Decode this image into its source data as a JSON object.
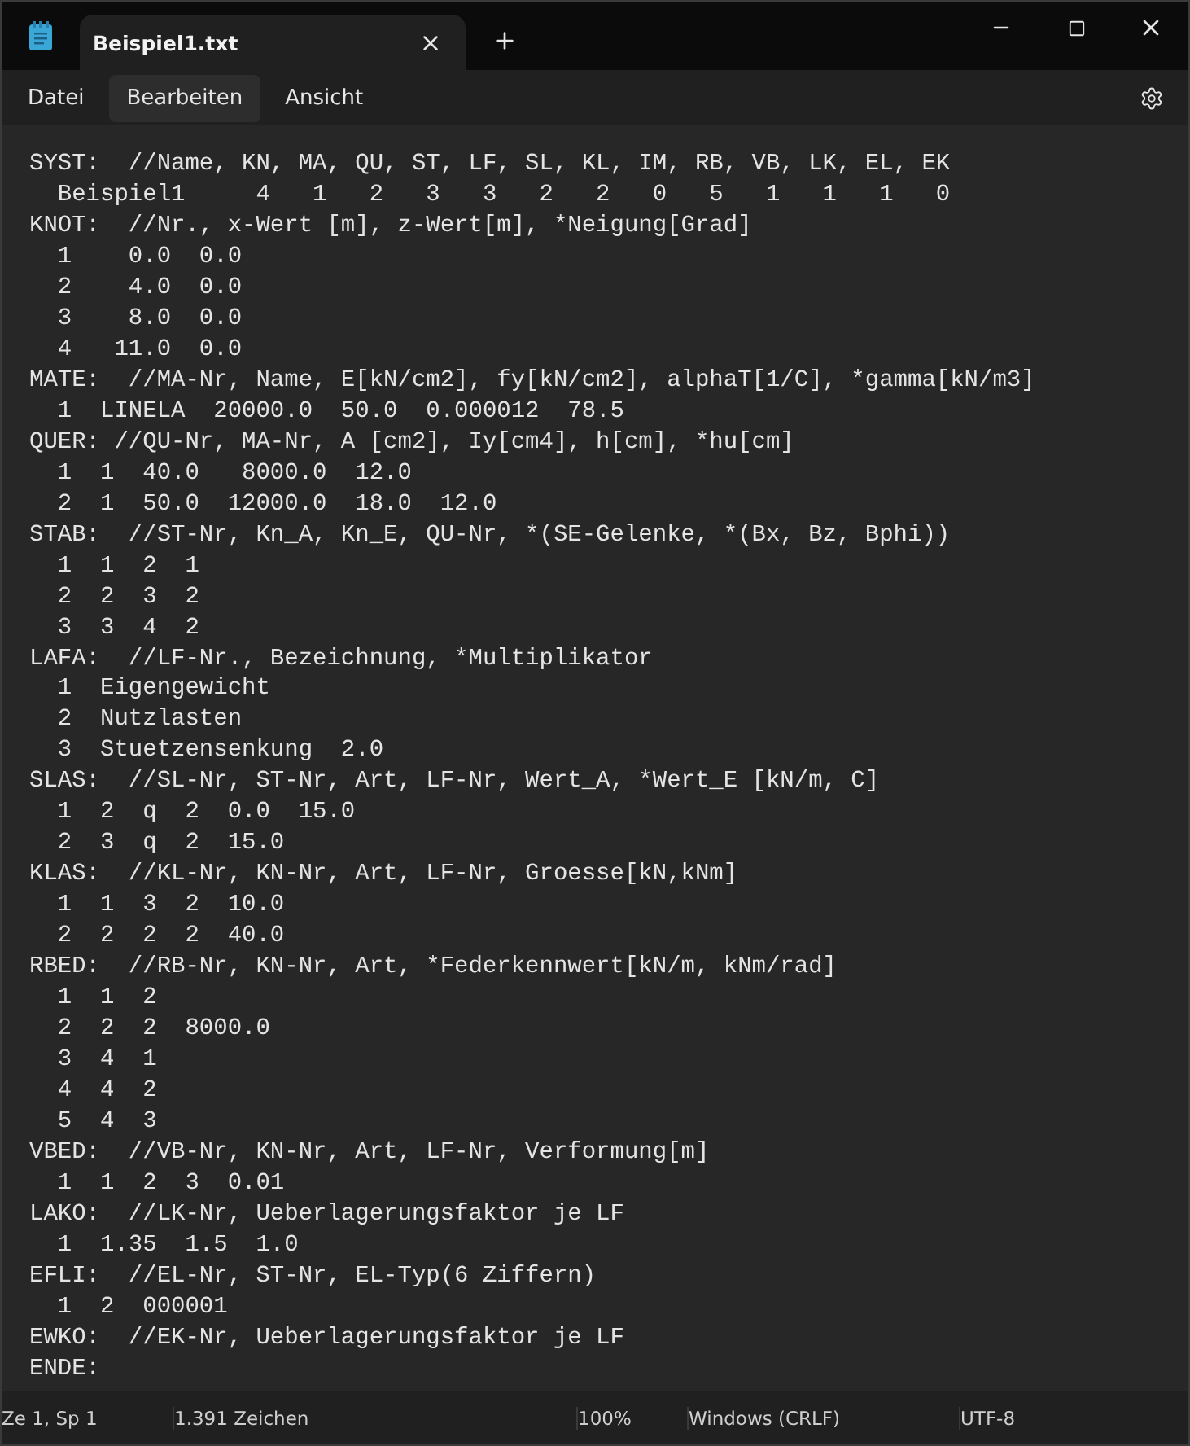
{
  "window": {
    "tab": {
      "title": "Beispiel1.txt",
      "selected": true
    }
  },
  "menu": [
    {
      "label": "Datei",
      "selected": false
    },
    {
      "label": "Bearbeiten",
      "selected": true
    },
    {
      "label": "Ansicht",
      "selected": false
    }
  ],
  "editor": {
    "lines": [
      "SYST:  //Name, KN, MA, QU, ST, LF, SL, KL, IM, RB, VB, LK, EL, EK",
      "  Beispiel1     4   1   2   3   3   2   2   0   5   1   1   1   0",
      "KNOT:  //Nr., x-Wert [m], z-Wert[m], *Neigung[Grad]",
      "  1    0.0  0.0",
      "  2    4.0  0.0",
      "  3    8.0  0.0",
      "  4   11.0  0.0",
      "MATE:  //MA-Nr, Name, E[kN/cm2], fy[kN/cm2], alphaT[1/C], *gamma[kN/m3]",
      "  1  LINELA  20000.0  50.0  0.000012  78.5",
      "QUER: //QU-Nr, MA-Nr, A [cm2], Iy[cm4], h[cm], *hu[cm]",
      "  1  1  40.0   8000.0  12.0",
      "  2  1  50.0  12000.0  18.0  12.0",
      "STAB:  //ST-Nr, Kn_A, Kn_E, QU-Nr, *(SE-Gelenke, *(Bx, Bz, Bphi))",
      "  1  1  2  1",
      "  2  2  3  2",
      "  3  3  4  2",
      "LAFA:  //LF-Nr., Bezeichnung, *Multiplikator",
      "  1  Eigengewicht",
      "  2  Nutzlasten",
      "  3  Stuetzensenkung  2.0",
      "SLAS:  //SL-Nr, ST-Nr, Art, LF-Nr, Wert_A, *Wert_E [kN/m, C]",
      "  1  2  q  2  0.0  15.0",
      "  2  3  q  2  15.0",
      "KLAS:  //KL-Nr, KN-Nr, Art, LF-Nr, Groesse[kN,kNm]",
      "  1  1  3  2  10.0",
      "  2  2  2  2  40.0",
      "RBED:  //RB-Nr, KN-Nr, Art, *Federkennwert[kN/m, kNm/rad]",
      "  1  1  2",
      "  2  2  2  8000.0",
      "  3  4  1",
      "  4  4  2",
      "  5  4  3",
      "VBED:  //VB-Nr, KN-Nr, Art, LF-Nr, Verformung[m]",
      "  1  1  2  3  0.01",
      "LAKO:  //LK-Nr, Ueberlagerungsfaktor je LF",
      "  1  1.35  1.5  1.0",
      "EFLI:  //EL-Nr, ST-Nr, EL-Typ(6 Ziffern)",
      "  1  2  000001",
      "EWKO:  //EK-Nr, Ueberlagerungsfaktor je LF",
      "ENDE:"
    ]
  },
  "status_bar": [
    "Ze 1, Sp 1",
    "1.391 Zeichen",
    "100%",
    "Windows (CRLF)",
    "UTF-8"
  ]
}
